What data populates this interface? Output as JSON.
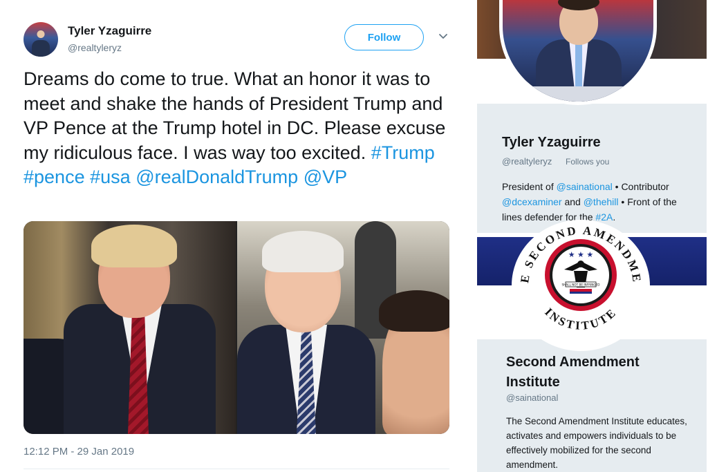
{
  "tweet": {
    "author_name": "Tyler Yzaguirre",
    "author_handle": "@realtyleryz",
    "follow_label": "Follow",
    "text_plain": "Dreams do come to true. What an honor it was to meet and shake the hands of President Trump and VP Pence at the Trump hotel in DC. Please excuse my ridiculous face. I was way too excited.",
    "tags": [
      "#Trump",
      "#pence",
      "#usa",
      "@realDonaldTrump",
      "@VP"
    ],
    "timestamp": "12:12 PM - 29 Jan 2019"
  },
  "profile_card_1": {
    "name": "Tyler Yzaguirre",
    "handle": "@realtyleryz",
    "follows_you": "Follows you",
    "bio": {
      "p1": "President of ",
      "link1": "@sainational",
      "p2": " • Contributor ",
      "link2": "@dcexaminer",
      "p3": " and ",
      "link3": "@thehill",
      "p4": " • Front of the lines defender for the ",
      "link4": "#2A",
      "p5": "."
    }
  },
  "profile_card_2": {
    "name": "Second Amendment Institute",
    "handle": "@sainational",
    "bio": "The Second Amendment Institute educates, activates and empowers individuals to be effectively mobilized for the second amendment.",
    "seal_text": "THE SECOND AMENDMENT INSTITUTE",
    "seal_motto": "SHALL NOT BE INFRINGED"
  },
  "colors": {
    "link": "#1b95e0",
    "follow_border": "#1da1f2",
    "muted": "#657786",
    "card_bg": "#e6ecf0",
    "banner_blue": "#1c2b7a",
    "seal_red": "#c8102e"
  },
  "icons": {
    "caret": "chevron-down-icon"
  }
}
